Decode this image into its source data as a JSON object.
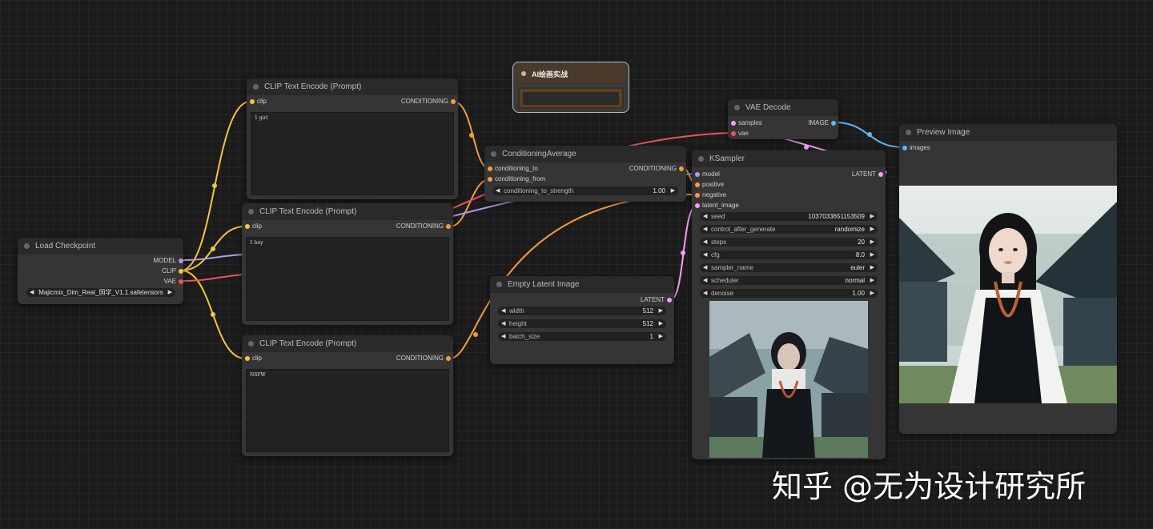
{
  "colors": {
    "clip": "#f5c542",
    "conditioning": "#f59b42",
    "model": "#b09ae8",
    "vae": "#e8555f",
    "latent": "#ff9cf9",
    "image": "#64b5f6"
  },
  "load_checkpoint": {
    "title": "Load Checkpoint",
    "outputs": [
      "MODEL",
      "CLIP",
      "VAE"
    ],
    "ckpt_value": "Majicmix_Dim_Real_国学_V1.1.safetensors"
  },
  "clip_encode_1": {
    "title": "CLIP Text Encode (Prompt)",
    "input": "clip",
    "output": "CONDITIONING",
    "text": "1 girl"
  },
  "clip_encode_2": {
    "title": "CLIP Text Encode (Prompt)",
    "input": "clip",
    "output": "CONDITIONING",
    "text": "1 boy"
  },
  "clip_encode_3": {
    "title": "CLIP Text Encode (Prompt)",
    "input": "clip",
    "output": "CONDITIONING",
    "text": "NSFW"
  },
  "group_note": {
    "title": "AI绘画实战"
  },
  "cond_avg": {
    "title": "ConditioningAverage",
    "inputs": [
      "conditioning_to",
      "conditioning_from"
    ],
    "output": "CONDITIONING",
    "strength_label": "conditioning_to_strength",
    "strength_value": "1.00"
  },
  "empty_latent": {
    "title": "Empty Latent Image",
    "output": "LATENT",
    "widgets": [
      {
        "name": "width",
        "value": "512"
      },
      {
        "name": "height",
        "value": "512"
      },
      {
        "name": "batch_size",
        "value": "1"
      }
    ]
  },
  "vae_decode": {
    "title": "VAE Decode",
    "inputs": [
      "samples",
      "vae"
    ],
    "output": "IMAGE"
  },
  "ksampler": {
    "title": "KSampler",
    "inputs": [
      "model",
      "positive",
      "negative",
      "latent_image"
    ],
    "output": "LATENT",
    "widgets": [
      {
        "name": "seed",
        "value": "1037033651153509"
      },
      {
        "name": "control_after_generate",
        "value": "randomize"
      },
      {
        "name": "steps",
        "value": "20"
      },
      {
        "name": "cfg",
        "value": "8.0"
      },
      {
        "name": "sampler_name",
        "value": "euler"
      },
      {
        "name": "scheduler",
        "value": "normal"
      },
      {
        "name": "denoise",
        "value": "1.00"
      }
    ]
  },
  "preview_image": {
    "title": "Preview Image",
    "input": "images"
  },
  "watermark": "知乎 @无为设计研究所"
}
